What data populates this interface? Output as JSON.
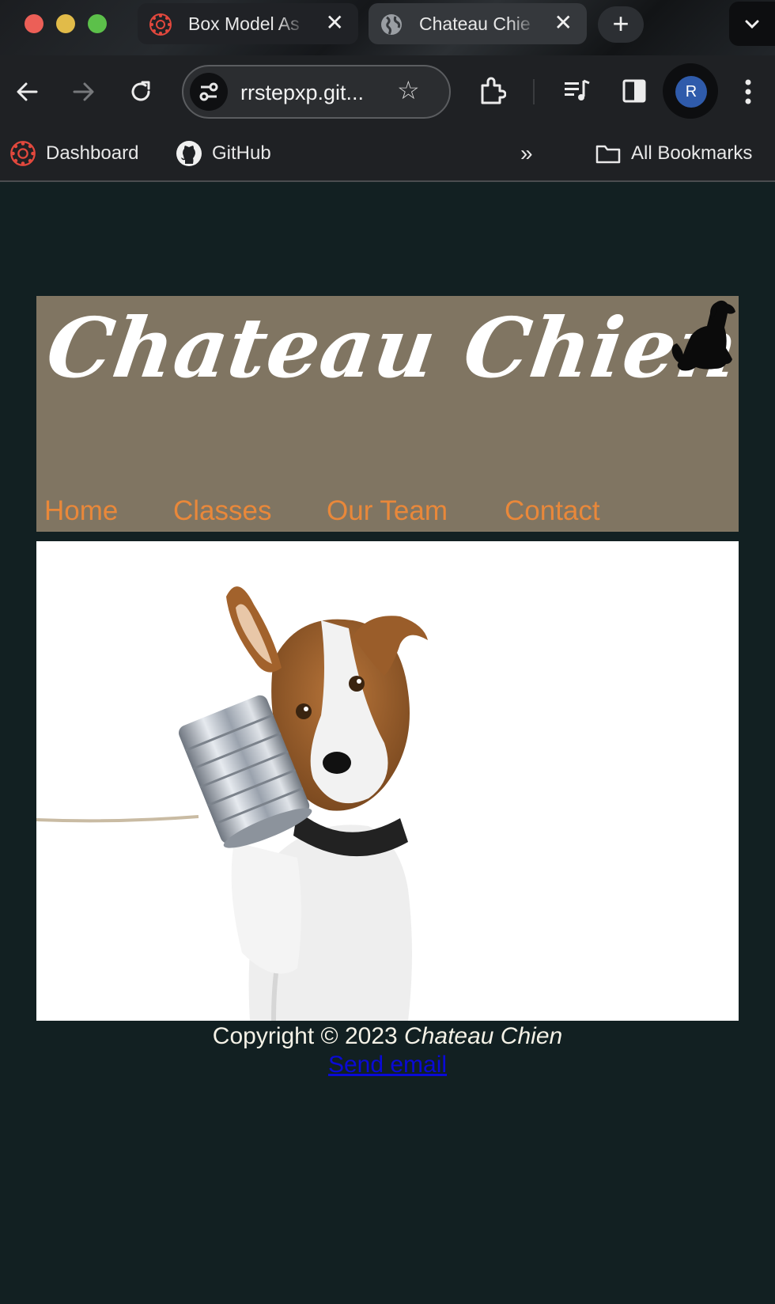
{
  "browser": {
    "tabs": [
      {
        "title": "Box Model As",
        "icon": "canvas-logo-icon",
        "active": false
      },
      {
        "title": "Chateau Chie",
        "icon": "globe-icon",
        "active": true
      }
    ],
    "new_tab_label": "+",
    "url": "rrstepxp.git...",
    "avatar_initial": "R",
    "bookmarks": [
      {
        "label": "Dashboard",
        "icon": "canvas-logo-icon"
      },
      {
        "label": "GitHub",
        "icon": "github-icon"
      }
    ],
    "all_bookmarks_label": "All Bookmarks"
  },
  "page": {
    "site_title": "Chateau Chien",
    "nav": [
      "Home",
      "Classes",
      "Our Team",
      "Contact"
    ],
    "nav_color": "#e9883a",
    "header_bg": "#807562",
    "page_bg": "#122022",
    "hero_image": "dog-holding-tin-can-phone-image",
    "footer": {
      "copyright_prefix": "Copyright © 2023",
      "copyright_brand": "Chateau Chien",
      "email_link": "Send email"
    }
  }
}
